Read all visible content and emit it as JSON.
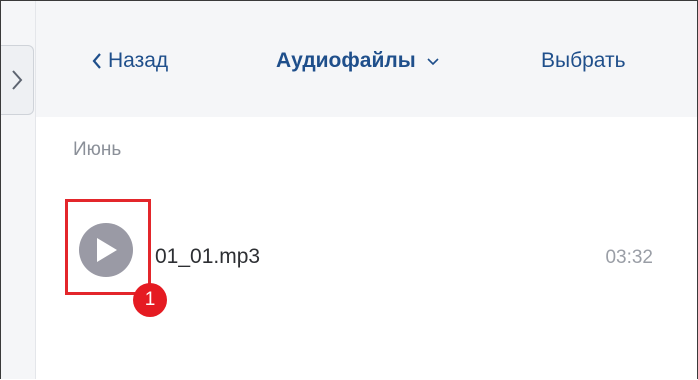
{
  "header": {
    "back_label": "Назад",
    "title": "Аудиофайлы",
    "select_label": "Выбрать"
  },
  "section": {
    "label": "Июнь"
  },
  "files": [
    {
      "name": "01_01.mp3",
      "duration": "03:32"
    }
  ],
  "callout": {
    "number": "1"
  },
  "icons": {
    "back": "chevron-left-icon",
    "title_dropdown": "chevron-down-icon",
    "side_toggle": "chevron-right-icon",
    "play": "play-icon"
  },
  "colors": {
    "accent": "#1f4f8b",
    "highlight": "#e3262b",
    "play_button": "#9a9aa5"
  }
}
